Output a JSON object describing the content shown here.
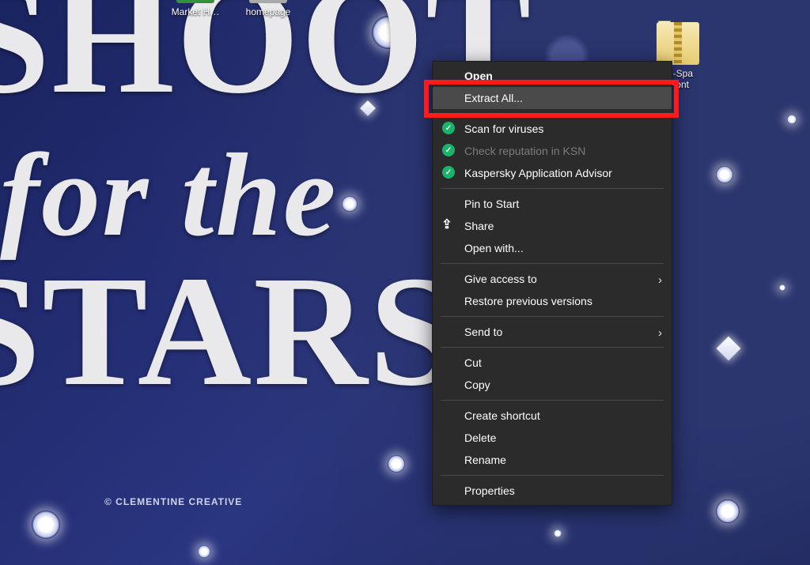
{
  "wallpaper": {
    "line1": "SHOOT",
    "line2": "for the",
    "line3": "STARS",
    "credit": "© CLEMENTINE CREATIVE"
  },
  "desktop_icons": {
    "market": "Market H…",
    "homepage": "homepage",
    "zip": {
      "line1": "ve-Spa",
      "line2": "-Font",
      "checked": "✓"
    }
  },
  "menu": {
    "open": "Open",
    "extract": "Extract All...",
    "scan": "Scan for viruses",
    "ksn": "Check reputation in KSN",
    "advisor": "Kaspersky Application Advisor",
    "pin": "Pin to Start",
    "share": "Share",
    "openwith": "Open with...",
    "access": "Give access to",
    "restore": "Restore previous versions",
    "sendto": "Send to",
    "cut": "Cut",
    "copy": "Copy",
    "shortcut": "Create shortcut",
    "delete": "Delete",
    "rename": "Rename",
    "props": "Properties"
  }
}
